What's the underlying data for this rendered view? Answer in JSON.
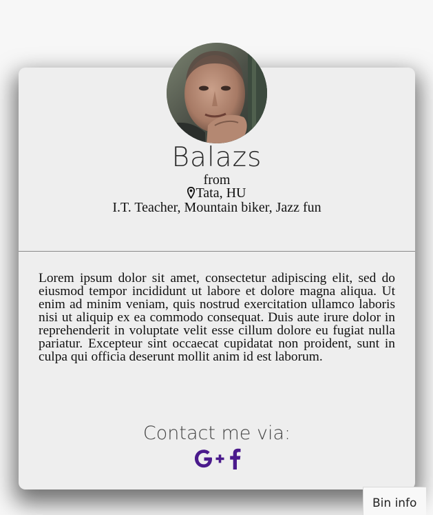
{
  "profile": {
    "name": "Balazs",
    "from_label": "from",
    "location": "Tata, HU",
    "tagline": "I.T. Teacher, Mountain biker, Jazz fun"
  },
  "bio": {
    "text": "Lorem ipsum dolor sit amet, consectetur adipiscing elit, sed do eiusmod tempor incididunt ut labore et dolore magna aliqua. Ut enim ad minim veniam, quis nostrud exercitation ullamco laboris nisi ut aliquip ex ea commodo consequat. Duis aute irure dolor in reprehenderit in voluptate velit esse cillum dolore eu fugiat nulla pariatur. Excepteur sint occaecat cupidatat non proident, sunt in culpa qui officia deserunt mollit anim id est laborum."
  },
  "contact": {
    "title": "Contact me via:",
    "links": [
      {
        "icon": "google-plus-icon",
        "color": "#4a1a8c"
      },
      {
        "icon": "facebook-icon",
        "color": "#4a1a8c"
      }
    ]
  },
  "bin_info": {
    "label": "Bin info"
  },
  "colors": {
    "card_bg": "#eeeeee",
    "page_bg": "#f7f7f7",
    "icon_accent": "#4a1a8c"
  }
}
